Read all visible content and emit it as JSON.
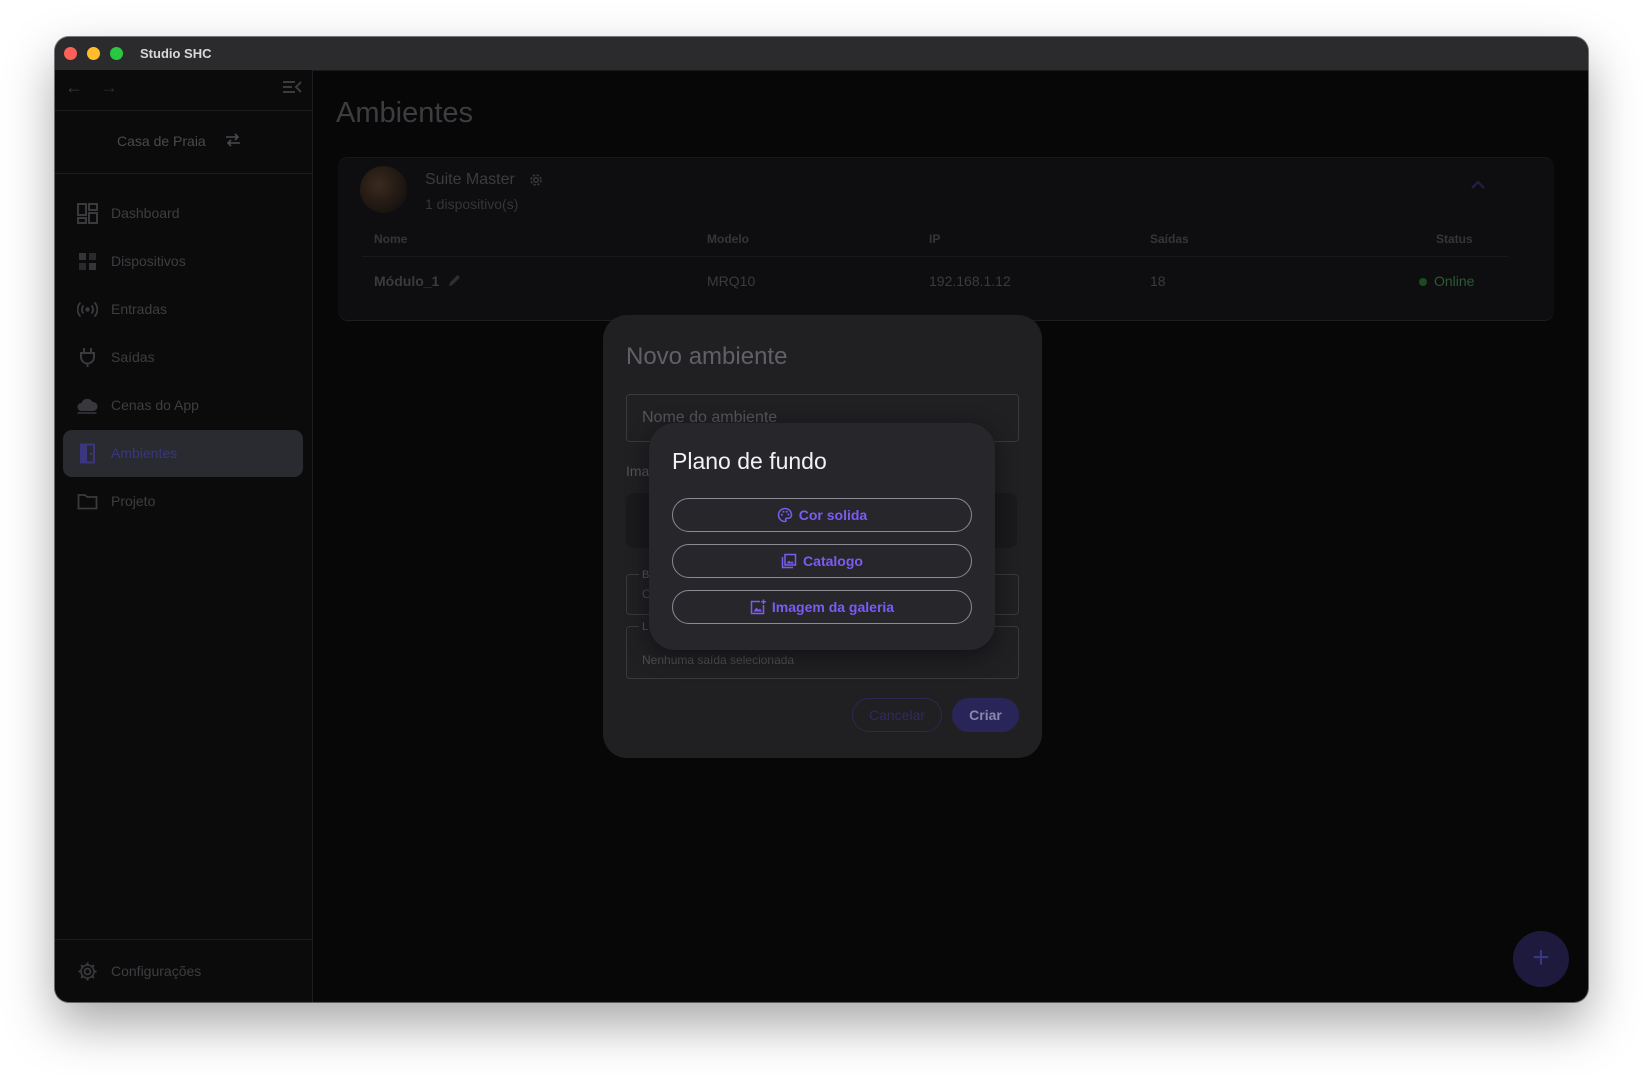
{
  "window": {
    "title": "Studio SHC"
  },
  "sidebar": {
    "project": "Casa de Praia",
    "items": [
      {
        "label": "Dashboard",
        "icon": "dashboard-icon"
      },
      {
        "label": "Dispositivos",
        "icon": "devices-icon"
      },
      {
        "label": "Entradas",
        "icon": "broadcast-icon"
      },
      {
        "label": "Saídas",
        "icon": "plug-icon"
      },
      {
        "label": "Cenas do App",
        "icon": "cloud-icon"
      },
      {
        "label": "Ambientes",
        "icon": "door-icon",
        "active": true
      },
      {
        "label": "Projeto",
        "icon": "folder-icon"
      }
    ],
    "settings": "Configurações"
  },
  "main": {
    "title": "Ambientes",
    "room": {
      "name": "Suite Master",
      "count": "1 dispositivo(s)",
      "headers": [
        "Nome",
        "Modelo",
        "IP",
        "Saídas",
        "Status"
      ],
      "row": {
        "name": "Módulo_1",
        "model": "MRQ10",
        "ip": "192.168.1.12",
        "outputs": "18",
        "status": "Online"
      }
    }
  },
  "dialog_new_room": {
    "title": "Novo ambiente",
    "name_placeholder": "Nome do ambiente",
    "image_section": "Ima",
    "field_b_label": "B",
    "field_b_value": "C",
    "field_l_label": "L",
    "field_l_value": "Nenhuma saída selecionada",
    "cancel": "Cancelar",
    "create": "Criar"
  },
  "dialog_background": {
    "title": "Plano de fundo",
    "options": [
      {
        "label": "Cor solida",
        "icon": "palette-icon"
      },
      {
        "label": "Catalogo",
        "icon": "image-library-icon"
      },
      {
        "label": "Imagem da galeria",
        "icon": "add-photo-icon"
      }
    ]
  },
  "colors": {
    "accent": "#7a5cf5",
    "online": "#2e5a34"
  }
}
